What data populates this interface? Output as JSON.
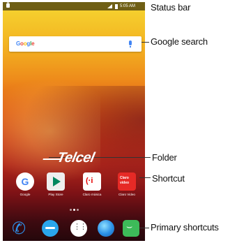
{
  "status_bar": {
    "time": "5:05 AM"
  },
  "search": {
    "logo": "Google"
  },
  "wallpaper": {
    "brand": "Telcel"
  },
  "home_apps": [
    {
      "label": "Google"
    },
    {
      "label": "Play Store"
    },
    {
      "label": "Claro música"
    },
    {
      "label": "Claro Video"
    }
  ],
  "page_indicator": {
    "pages": 3,
    "current": 2
  },
  "dock_icons": [
    "phone-icon",
    "messages-icon",
    "apps-drawer-icon",
    "browser-icon",
    "chat-icon"
  ],
  "callouts": {
    "status_bar": "Status bar",
    "google_search": "Google search",
    "folder": "Folder",
    "shortcut": "Shortcut",
    "primary_shortcuts": "Primary shortcuts"
  }
}
